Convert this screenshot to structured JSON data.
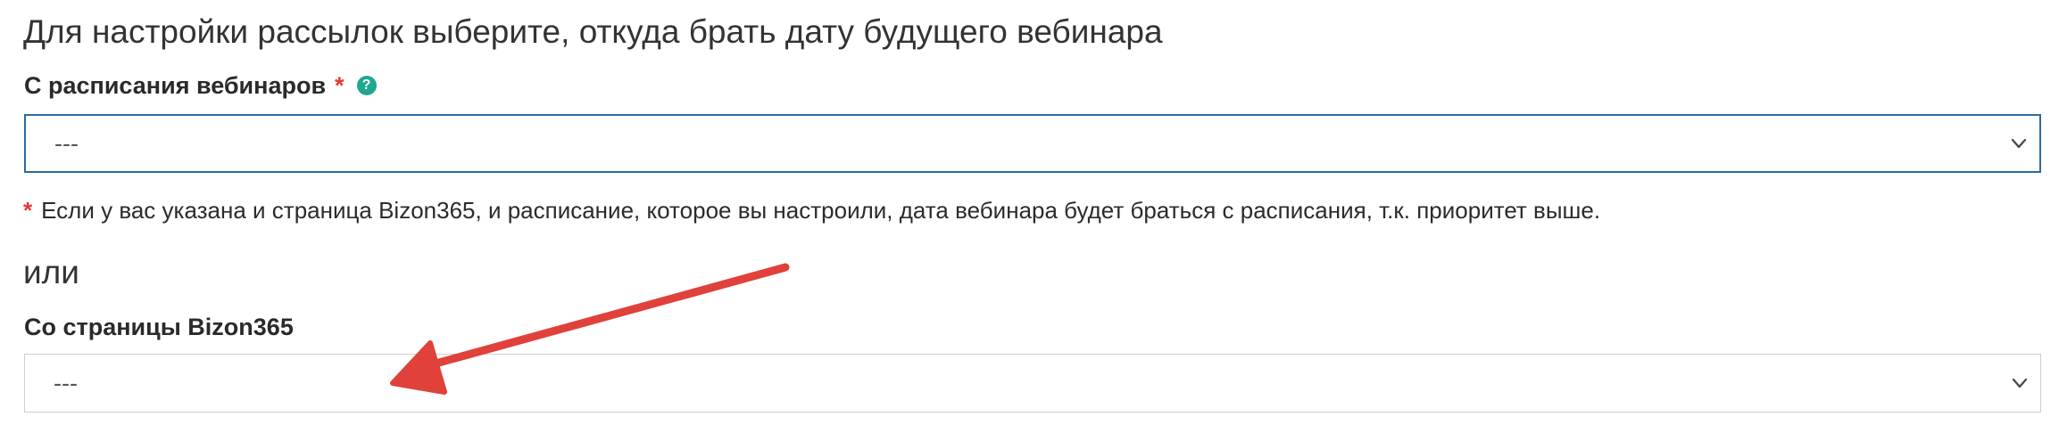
{
  "heading": "Для настройки рассылок выберите, откуда брать дату будущего вебинара",
  "schedule_field": {
    "label": "С расписания вебинаров",
    "required_mark": "*",
    "help_glyph": "?",
    "selected_value": "---"
  },
  "note": {
    "star": "*",
    "text": "Если у вас указана и страница Bizon365, и расписание, которое вы настроили, дата вебинара будет браться с расписания, т.к. приоритет выше."
  },
  "or_text": "или",
  "page_field": {
    "label": "Со страницы Bizon365",
    "selected_value": "---"
  },
  "icons": {
    "help": "question-circle-icon",
    "chevron": "chevron-down-icon",
    "annotation": "red-arrow-annotation"
  },
  "colors": {
    "accent_teal": "#1fa88f",
    "required_red": "#e53935",
    "focus_border": "#2b6b9c",
    "annotation_red": "#e0413a"
  }
}
